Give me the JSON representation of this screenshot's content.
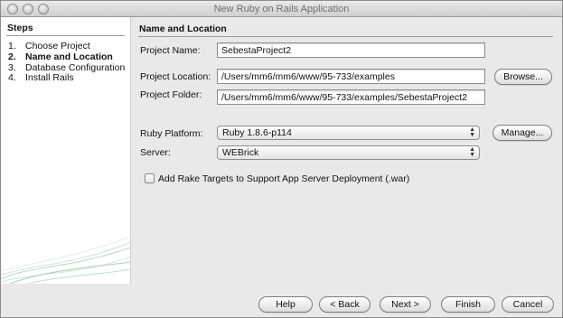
{
  "window": {
    "title": "New Ruby on Rails Application"
  },
  "steps": {
    "title": "Steps",
    "items": [
      {
        "num": "1.",
        "label": "Choose Project"
      },
      {
        "num": "2.",
        "label": "Name and Location"
      },
      {
        "num": "3.",
        "label": "Database Configuration"
      },
      {
        "num": "4.",
        "label": "Install Rails"
      }
    ],
    "current_index": 1
  },
  "main": {
    "section_title": "Name and Location",
    "project_name": {
      "label": "Project Name:",
      "value": "SebestaProject2"
    },
    "project_location": {
      "label": "Project Location:",
      "value": "/Users/mm6/mm6/www/95-733/examples",
      "browse_label": "Browse..."
    },
    "project_folder": {
      "label": "Project Folder:",
      "value": "/Users/mm6/mm6/www/95-733/examples/SebestaProject2"
    },
    "ruby_platform": {
      "label": "Ruby Platform:",
      "selected": "Ruby 1.8.6-p114",
      "manage_label": "Manage..."
    },
    "server": {
      "label": "Server:",
      "selected": "WEBrick"
    },
    "rake_targets": {
      "label": "Add Rake Targets to Support App Server Deployment (.war)",
      "checked": false
    }
  },
  "footer": {
    "help_label": "Help",
    "back_label": "< Back",
    "next_label": "Next >",
    "finish_label": "Finish",
    "cancel_label": "Cancel"
  },
  "icons": {
    "close": "close-icon",
    "minimize": "minimize-icon",
    "zoom": "zoom-icon",
    "select_arrows": "updown-arrows-icon"
  }
}
